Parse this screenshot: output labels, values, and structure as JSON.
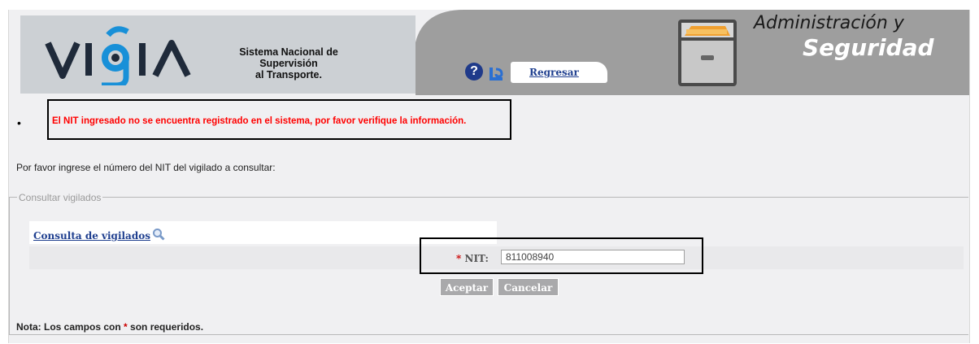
{
  "header": {
    "logo_word": "VIGIA",
    "subtitle_line1": "Sistema Nacional de Supervisión",
    "subtitle_line2": "al Transporte.",
    "help_symbol": "?",
    "back_label": "Regresar",
    "section_title_line1": "Administración y",
    "section_title_line2": "Seguridad"
  },
  "messages": {
    "error": "El NIT ingresado no se encuentra registrado en el sistema, por favor verifique la información."
  },
  "form": {
    "instruction": "Por favor ingrese el número del NIT del vigilado a consultar:",
    "legend": "Consultar vigilados",
    "query_link": "Consulta de vigilados",
    "nit_required_mark": "*",
    "nit_label": "NIT:",
    "nit_value": "811008940",
    "accept_label": "Aceptar",
    "cancel_label": "Cancelar",
    "note_prefix": "Nota: Los campos con",
    "note_star": "*",
    "note_suffix": "son requeridos."
  },
  "colors": {
    "error": "#ff0000",
    "link": "#1f3f8f",
    "banner_gray": "#9e9e9e",
    "button_gray": "#a9a9ab"
  },
  "icons": [
    "help-icon",
    "back-icon",
    "cabinet-icon",
    "search-icon"
  ]
}
